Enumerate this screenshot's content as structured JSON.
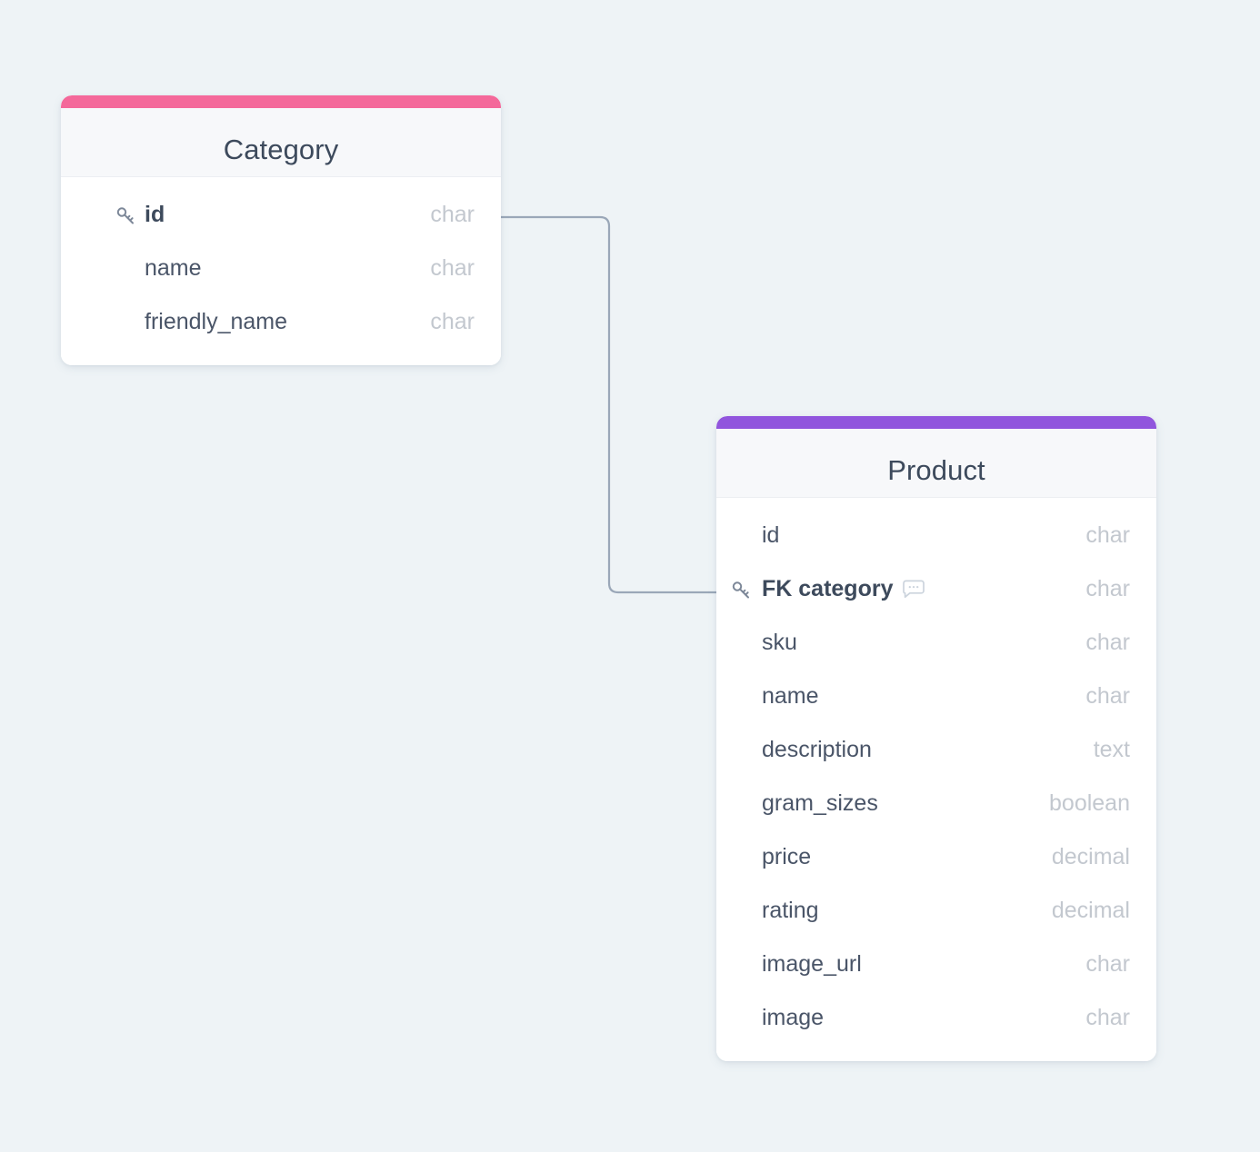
{
  "diagram": {
    "type": "entity-relationship-diagram",
    "background_color": "#eef3f6",
    "connector_color": "#9aa7b8"
  },
  "entities": [
    {
      "name": "Category",
      "accent_color": "#f4689a",
      "fields": [
        {
          "name": "id",
          "type": "char",
          "key": true,
          "comment": false
        },
        {
          "name": "name",
          "type": "char",
          "key": false,
          "comment": false
        },
        {
          "name": "friendly_name",
          "type": "char",
          "key": false,
          "comment": false
        }
      ]
    },
    {
      "name": "Product",
      "accent_color": "#9155dd",
      "fields": [
        {
          "name": "id",
          "type": "char",
          "key": false,
          "comment": false
        },
        {
          "name": "FK category",
          "type": "char",
          "key": true,
          "comment": true
        },
        {
          "name": "sku",
          "type": "char",
          "key": false,
          "comment": false
        },
        {
          "name": "name",
          "type": "char",
          "key": false,
          "comment": false
        },
        {
          "name": "description",
          "type": "text",
          "key": false,
          "comment": false
        },
        {
          "name": "gram_sizes",
          "type": "boolean",
          "key": false,
          "comment": false
        },
        {
          "name": "price",
          "type": "decimal",
          "key": false,
          "comment": false
        },
        {
          "name": "rating",
          "type": "decimal",
          "key": false,
          "comment": false
        },
        {
          "name": "image_url",
          "type": "char",
          "key": false,
          "comment": false
        },
        {
          "name": "image",
          "type": "char",
          "key": false,
          "comment": false
        }
      ]
    }
  ],
  "relationships": [
    {
      "from_entity": "Category",
      "from_field": "id",
      "to_entity": "Product",
      "to_field": "FK category"
    }
  ],
  "icons": {
    "key": "key-icon",
    "comment": "comment-icon"
  }
}
